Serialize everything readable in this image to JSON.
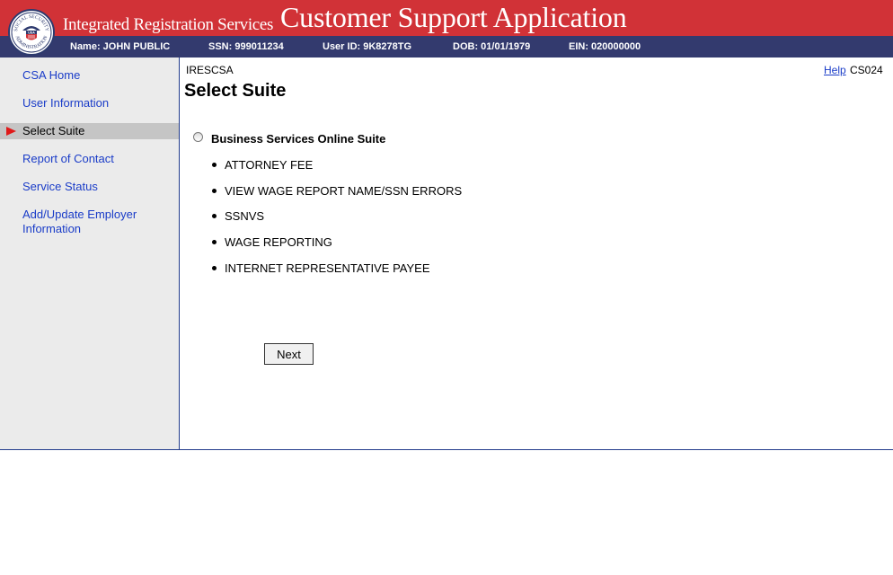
{
  "header": {
    "org_title": "Integrated Registration Services",
    "app_title": "Customer Support Application",
    "seal": {
      "top_text": "SOCIAL SECURITY",
      "bottom_text": "ADMINISTRATION",
      "center_text": "USA"
    },
    "colors": {
      "header_red": "#d13237",
      "info_bar_navy": "#333a6e",
      "link_blue": "#1a3cc8"
    }
  },
  "user_info": {
    "name": "Name: JOHN PUBLIC",
    "ssn": "SSN: 999011234",
    "user_id": "User ID: 9K8278TG",
    "dob": "DOB: 01/01/1979",
    "ein": "EIN: 020000000"
  },
  "sidebar": {
    "items": [
      {
        "label": "CSA Home"
      },
      {
        "label": "User Information"
      },
      {
        "label": "Select Suite",
        "active": true,
        "indicator_icon": "red-arrow-icon"
      },
      {
        "label": "Report of Contact"
      },
      {
        "label": "Service Status"
      },
      {
        "label": "Add/Update Employer Information"
      }
    ]
  },
  "main": {
    "app_code": "IRESCSA",
    "help_link": "Help",
    "screen_id": "CS024",
    "page_title": "Select Suite",
    "suite": {
      "label": "Business Services Online Suite",
      "selected": false,
      "services": [
        "ATTORNEY FEE",
        "VIEW WAGE REPORT NAME/SSN ERRORS",
        "SSNVS",
        "WAGE REPORTING",
        "INTERNET REPRESENTATIVE PAYEE"
      ]
    },
    "next_button": "Next"
  }
}
